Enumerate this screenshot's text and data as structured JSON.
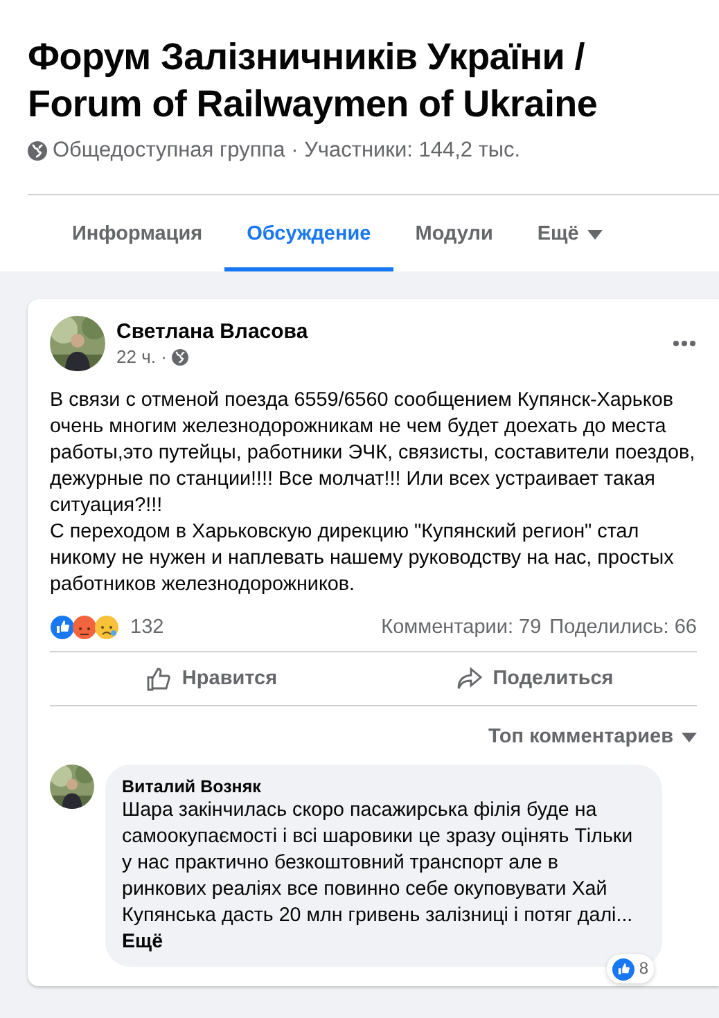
{
  "group": {
    "title": "Форум Залізничників України / Forum of Railwaymen of Ukraine",
    "privacy": "Общедоступная группа",
    "separator": "·",
    "members": "Участники: 144,2 тыс."
  },
  "tabs": [
    {
      "label": "Информация",
      "selected": false
    },
    {
      "label": "Обсуждение",
      "selected": true
    },
    {
      "label": "Модули",
      "selected": false
    },
    {
      "label": "Ещё",
      "selected": false,
      "kind": "dropdown"
    }
  ],
  "post": {
    "author": "Светлана Власова",
    "time": "22 ч.",
    "time_separator": "·",
    "paragraphs": [
      "В связи с отменой поезда 6559/6560 сообщением Купянск-Харьков очень многим железнодорожникам не чем будет доехать до места работы,это  путейцы, работники ЭЧК, связисты, составители поездов, дежурные по станции!!!! Все молчат!!! Или всех устраивает такая ситуация?!!!",
      "С переходом в Харьковскую дирекцию \"Купянский регион\" стал никому не нужен и наплевать нашему руководству на нас, простых работников железнодорожников."
    ],
    "reactions_count": "132",
    "comments": "Комментарии: 79",
    "shares": "Поделились: 66",
    "actions": [
      {
        "label": "Нравится",
        "kind": "like"
      },
      {
        "label": "Поделиться",
        "kind": "share"
      }
    ],
    "sort": "Топ комментариев"
  },
  "comments": [
    {
      "author": "Виталий Возняк",
      "text": "Шара закінчилась скоро пасажирська філія буде на самоокупаємості і всі шаровики це зразу оцінять Тільки у нас практично безкоштовний транспорт але в ринкових реаліях все повинно себе окуповувати Хай Купянська дасть 20 млн гривень залізниці і потяг далі...",
      "more": "Ещё",
      "reactions_count": "8"
    }
  ]
}
